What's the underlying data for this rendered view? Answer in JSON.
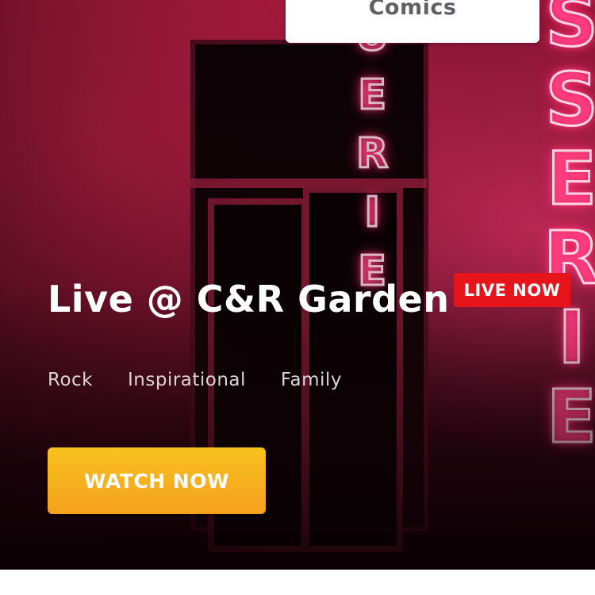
{
  "hero": {
    "category": "Comics",
    "title": "Live @ C&R Garden",
    "live_badge": "LIVE NOW",
    "genres": [
      "Rock",
      "Inspirational",
      "Family"
    ],
    "cta_label": "WATCH NOW"
  },
  "colors": {
    "live_badge": "#e8141c",
    "cta_top": "#f8c11d",
    "cta_bottom": "#f4a11e",
    "category_text": "#5f5f66"
  }
}
